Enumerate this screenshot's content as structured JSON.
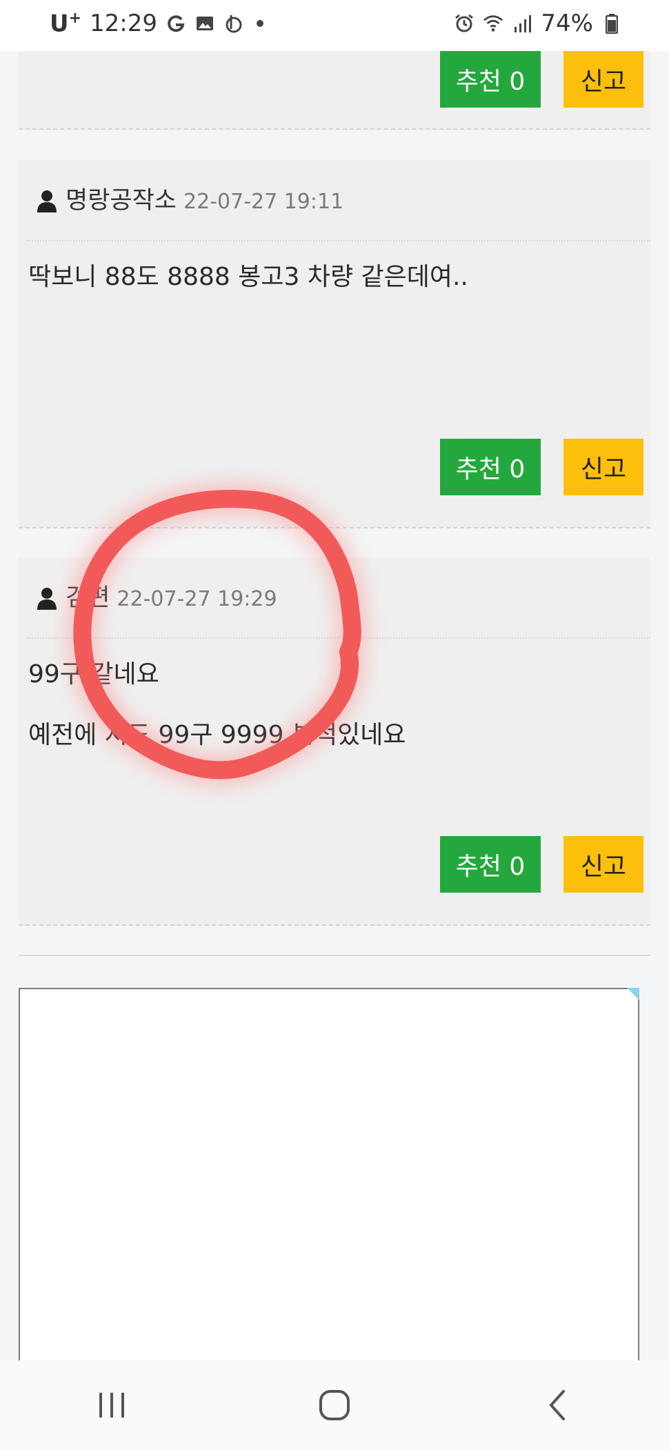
{
  "status": {
    "carrier": "U",
    "carrier_sup": "+",
    "time": "12:29",
    "battery": "74%"
  },
  "comments": [
    {
      "author": "",
      "timestamp": "",
      "lines": [],
      "recommend_label": "추천 0",
      "report_label": "신고"
    },
    {
      "author": "명랑공작소",
      "timestamp": "22-07-27 19:11",
      "lines": [
        "딱보니 88도 8888 봉고3 차량 같은데여.."
      ],
      "recommend_label": "추천 0",
      "report_label": "신고"
    },
    {
      "author": "검편",
      "timestamp": "22-07-27 19:29",
      "lines": [
        "99구 같네요",
        "예전에 저도 99구 9999 본적있네요"
      ],
      "recommend_label": "추천 0",
      "report_label": "신고"
    }
  ],
  "icons": {
    "user": "user-icon",
    "recent_apps": "recent-apps-icon",
    "home": "home-icon",
    "back": "back-icon"
  },
  "colors": {
    "recommend": "#24a83d",
    "report": "#fbbf0c",
    "annotation": "#f25a5a"
  }
}
